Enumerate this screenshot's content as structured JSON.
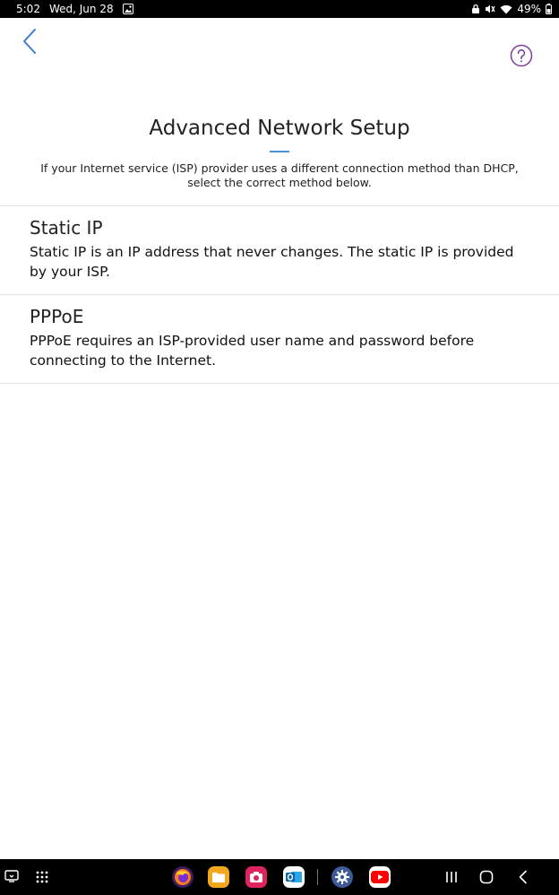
{
  "status_bar": {
    "time": "5:02",
    "date": "Wed, Jun 28",
    "battery": "49%"
  },
  "header": {
    "back_icon": "chevron-left-icon",
    "help_icon": "question-circle-icon",
    "accent_color": "#3b7bd4",
    "help_color": "#7a3e9d"
  },
  "main": {
    "title": "Advanced Network Setup",
    "subtitle": "If your Internet service (ISP) provider uses a different connection method than DHCP, select the correct method below.",
    "options": [
      {
        "title": "Static IP",
        "description": "Static IP is an IP address that never changes. The static IP is provided by your ISP."
      },
      {
        "title": "PPPoE",
        "description": "PPPoE requires an ISP-provided user name and password before connecting to the Internet."
      }
    ]
  },
  "nav_bar": {
    "dock_apps": [
      "firefox-icon",
      "files-icon",
      "camera-icon",
      "outlook-icon",
      "settings-icon",
      "youtube-icon"
    ],
    "buttons": [
      "recents-icon",
      "home-icon",
      "back-icon"
    ]
  }
}
